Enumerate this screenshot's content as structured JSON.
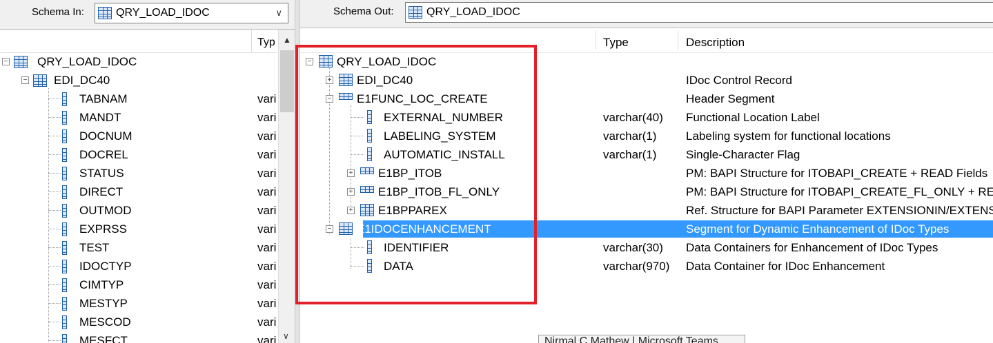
{
  "left_panel": {
    "label": "Schema In:",
    "schema_name": "QRY_LOAD_IDOC",
    "column_type": "Typ",
    "root": "QRY_LOAD_IDOC",
    "child": "EDI_DC40",
    "fields": [
      {
        "name": "TABNAM",
        "type": "vari"
      },
      {
        "name": "MANDT",
        "type": "vari"
      },
      {
        "name": "DOCNUM",
        "type": "vari"
      },
      {
        "name": "DOCREL",
        "type": "vari"
      },
      {
        "name": "STATUS",
        "type": "vari"
      },
      {
        "name": "DIRECT",
        "type": "vari"
      },
      {
        "name": "OUTMOD",
        "type": "vari"
      },
      {
        "name": "EXPRSS",
        "type": "vari"
      },
      {
        "name": "TEST",
        "type": "vari"
      },
      {
        "name": "IDOCTYP",
        "type": "vari"
      },
      {
        "name": "CIMTYP",
        "type": "vari"
      },
      {
        "name": "MESTYP",
        "type": "vari"
      },
      {
        "name": "MESCOD",
        "type": "vari"
      },
      {
        "name": "MESFCT",
        "type": "vari"
      }
    ]
  },
  "right_panel": {
    "label": "Schema Out:",
    "schema_name": "QRY_LOAD_IDOC",
    "column_type": "Type",
    "column_description": "Description",
    "rows": [
      {
        "name": "QRY_LOAD_IDOC",
        "type": "",
        "description": ""
      },
      {
        "name": "EDI_DC40",
        "type": "",
        "description": "IDoc Control Record"
      },
      {
        "name": "E1FUNC_LOC_CREATE",
        "type": "",
        "description": "Header Segment"
      },
      {
        "name": "EXTERNAL_NUMBER",
        "type": "varchar(40)",
        "description": "Functional Location Label"
      },
      {
        "name": "LABELING_SYSTEM",
        "type": "varchar(1)",
        "description": "Labeling system for functional locations"
      },
      {
        "name": "AUTOMATIC_INSTALL",
        "type": "varchar(1)",
        "description": "Single-Character Flag"
      },
      {
        "name": "E1BP_ITOB",
        "type": "",
        "description": "PM: BAPI Structure for ITOBAPI_CREATE + READ Fields"
      },
      {
        "name": "E1BP_ITOB_FL_ONLY",
        "type": "",
        "description": "PM: BAPI Structure for ITOBAPI_CREATE_FL_ONLY + REAI"
      },
      {
        "name": "E1BPPAREX",
        "type": "",
        "description": "Ref. Structure for BAPI Parameter EXTENSIONIN/EXTENSI"
      },
      {
        "name": "E1IDOCENHANCEMENT",
        "type": "",
        "description": "Segment for Dynamic Enhancement of IDoc Types"
      },
      {
        "name": "IDENTIFIER",
        "type": "varchar(30)",
        "description": "Data Containers for Enhancement of IDoc Types"
      },
      {
        "name": "DATA",
        "type": "varchar(970)",
        "description": "Data Container for IDoc Enhancement"
      }
    ]
  },
  "tooltip": "Nirmal C Mathew | Microsoft Teams",
  "colors": {
    "selection": "#3399ff",
    "highlight_box": "#e3202a"
  }
}
